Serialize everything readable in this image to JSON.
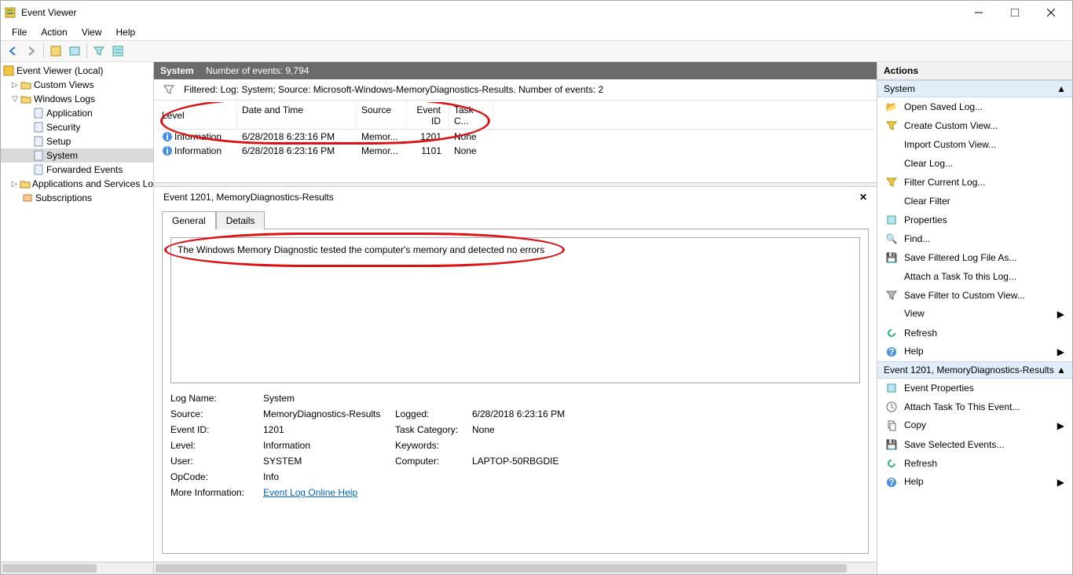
{
  "title": "Event Viewer",
  "menus": {
    "file": "File",
    "action": "Action",
    "view": "View",
    "help": "Help"
  },
  "tree": {
    "root": "Event Viewer (Local)",
    "custom": "Custom Views",
    "winlogs": "Windows Logs",
    "app": "Application",
    "sec": "Security",
    "setup": "Setup",
    "system": "System",
    "fwd": "Forwarded Events",
    "svc": "Applications and Services Lo",
    "subs": "Subscriptions"
  },
  "center": {
    "title": "System",
    "count": "Number of events: 9,794",
    "filter": "Filtered: Log: System; Source: Microsoft-Windows-MemoryDiagnostics-Results. Number of events: 2",
    "cols": {
      "level": "Level",
      "date": "Date and Time",
      "source": "Source",
      "id": "Event ID",
      "task": "Task C..."
    },
    "rows": [
      {
        "level": "Information",
        "date": "6/28/2018 6:23:16 PM",
        "source": "Memor...",
        "id": "1201",
        "task": "None"
      },
      {
        "level": "Information",
        "date": "6/28/2018 6:23:16 PM",
        "source": "Memor...",
        "id": "1101",
        "task": "None"
      }
    ]
  },
  "detail": {
    "title": "Event 1201, MemoryDiagnostics-Results",
    "tabs": {
      "general": "General",
      "details": "Details"
    },
    "message": "The Windows Memory Diagnostic tested the computer's memory and detected no errors",
    "labels": {
      "logname": "Log Name:",
      "source": "Source:",
      "logged": "Logged:",
      "eventid": "Event ID:",
      "taskcat": "Task Category:",
      "level": "Level:",
      "keywords": "Keywords:",
      "user": "User:",
      "computer": "Computer:",
      "opcode": "OpCode:",
      "moreinfo": "More Information:"
    },
    "vals": {
      "logname": "System",
      "source": "MemoryDiagnostics-Results",
      "logged": "6/28/2018 6:23:16 PM",
      "eventid": "1201",
      "taskcat": "None",
      "level": "Information",
      "keywords": "",
      "user": "SYSTEM",
      "computer": "LAPTOP-50RBGDIE",
      "opcode": "Info",
      "moreinfo": "Event Log Online Help"
    }
  },
  "actions": {
    "title": "Actions",
    "group1": "System",
    "items1": {
      "open": "Open Saved Log...",
      "create": "Create Custom View...",
      "import": "Import Custom View...",
      "clear": "Clear Log...",
      "filter": "Filter Current Log...",
      "clearfilter": "Clear Filter",
      "props": "Properties",
      "find": "Find...",
      "savefilt": "Save Filtered Log File As...",
      "attach": "Attach a Task To this Log...",
      "savecust": "Save Filter to Custom View...",
      "view": "View",
      "refresh": "Refresh",
      "help": "Help"
    },
    "group2": "Event 1201, MemoryDiagnostics-Results",
    "items2": {
      "evprops": "Event Properties",
      "attach2": "Attach Task To This Event...",
      "copy": "Copy",
      "savesel": "Save Selected Events...",
      "refresh2": "Refresh",
      "help2": "Help"
    }
  }
}
